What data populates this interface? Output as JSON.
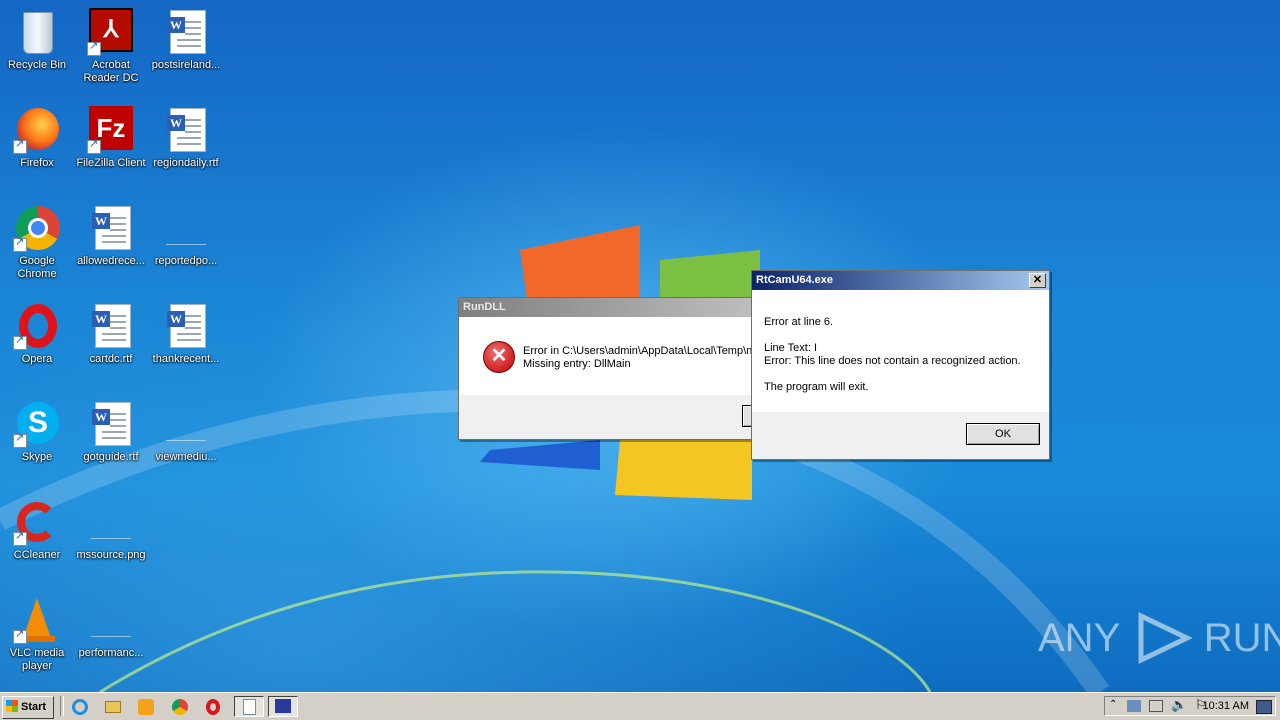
{
  "desktop_icons": {
    "recycle_bin": "Recycle Bin",
    "acrobat": "Acrobat Reader DC",
    "postsireland": "postsireland...",
    "firefox": "Firefox",
    "filezilla": "FileZilla Client",
    "regiondaily": "regiondaily.rtf",
    "chrome": "Google Chrome",
    "allowedrece": "allowedrece...",
    "reportedpo": "reportedpo...",
    "opera": "Opera",
    "cartdc": "cartdc.rtf",
    "thankrecent": "thankrecent...",
    "skype": "Skype",
    "gotguide": "gotguide.rtf",
    "viewmediu": "viewmediu...",
    "ccleaner": "CCleaner",
    "mssource": "mssource.png",
    "vlc": "VLC media player",
    "performance": "performanc..."
  },
  "rundll_dialog": {
    "title": "RunDLL",
    "line1": "Error in C:\\Users\\admin\\AppData\\Local\\Temp\\ni",
    "line2": "Missing entry: DllMain"
  },
  "rtcam_dialog": {
    "title": "RtCamU64.exe",
    "close_label": "✕",
    "line1": "Error at line 6.",
    "line2": "Line Text: I",
    "line3": "Error: This line does not contain a recognized action.",
    "line4": "The program will exit.",
    "ok_label": "OK"
  },
  "taskbar": {
    "start_label": "Start",
    "clock": "10:31 AM"
  },
  "watermark": {
    "left": "ANY",
    "right": "RUN"
  }
}
